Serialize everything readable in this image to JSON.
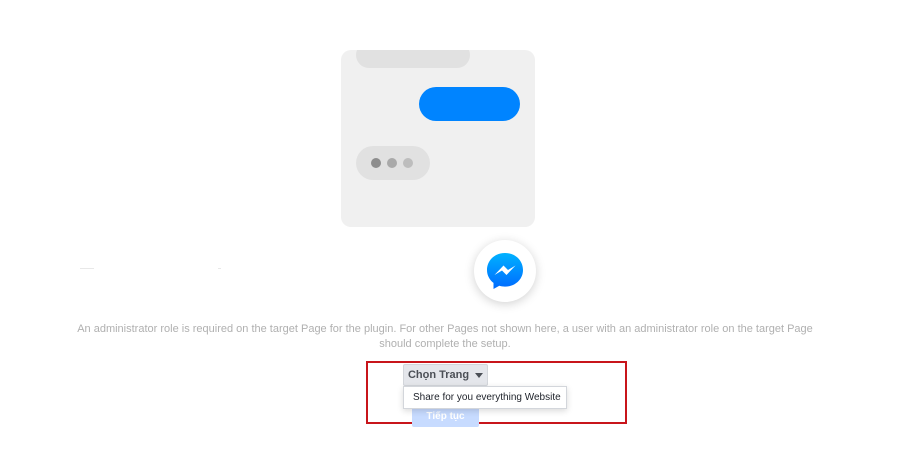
{
  "notice": {
    "line1": "An administrator role is required on the target Page for the plugin. For other Pages not shown here, a user with an administrator role on the target Page",
    "line2": "should complete the setup."
  },
  "page_select": {
    "label": "Chọn Trang",
    "caret_icon": "caret-down-icon"
  },
  "dropdown": {
    "options": [
      "Share for you everything Website"
    ]
  },
  "continue_button": {
    "label": "Tiếp tục"
  },
  "illustration": {
    "badge_icon": "messenger-icon",
    "brand_color": "#0084ff",
    "highlight_color": "#c8151b"
  }
}
